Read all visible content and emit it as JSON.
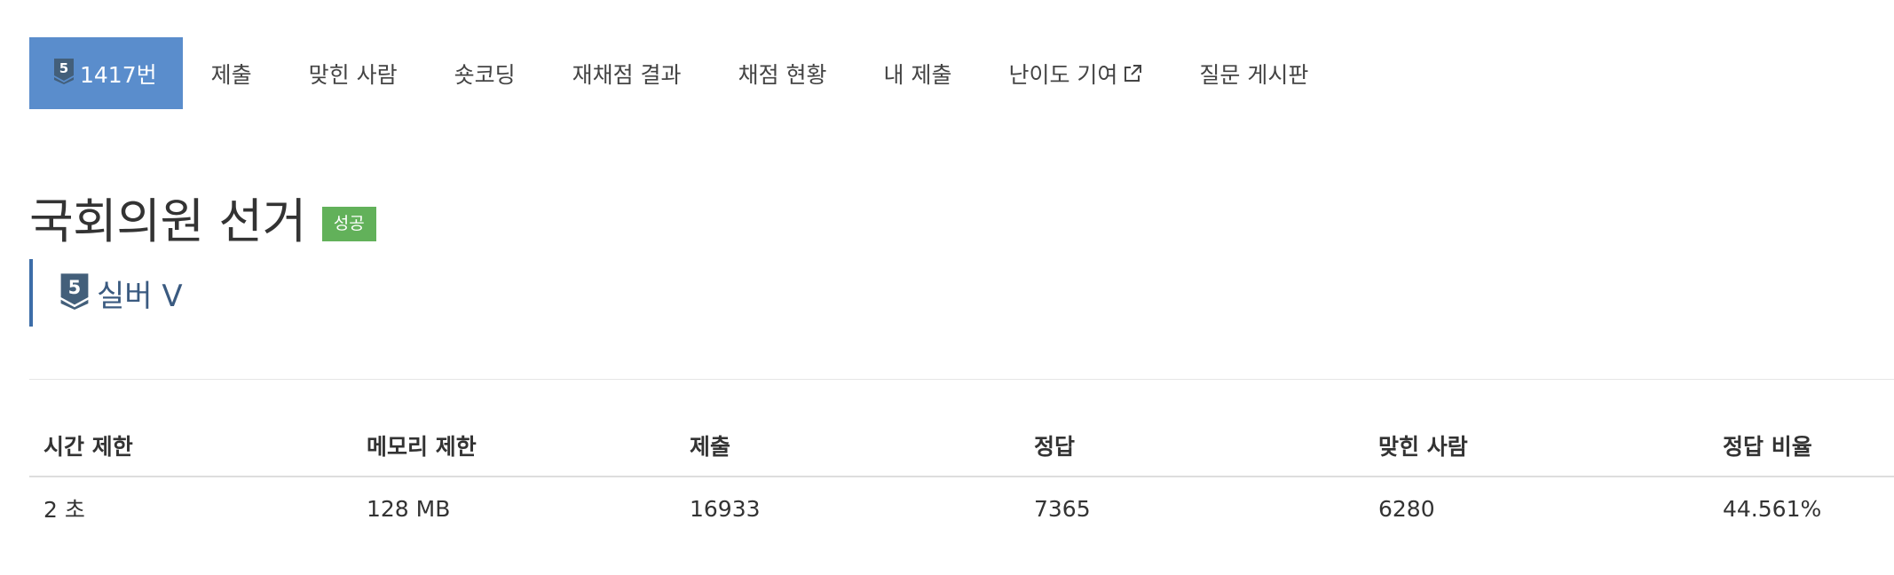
{
  "tabs": [
    {
      "label": "1417번",
      "active": true,
      "tier_icon": "tier-silver-5",
      "tier_digit": "5"
    },
    {
      "label": "제출"
    },
    {
      "label": "맞힌 사람"
    },
    {
      "label": "숏코딩"
    },
    {
      "label": "재채점 결과"
    },
    {
      "label": "채점 현황"
    },
    {
      "label": "내 제출"
    },
    {
      "label": "난이도 기여",
      "icon": "external-link-icon"
    },
    {
      "label": "질문 게시판"
    }
  ],
  "problem": {
    "title": "국회의원 선거",
    "status_badge": "성공",
    "tier_digit": "5",
    "tier_label": "실버 V"
  },
  "stats": {
    "headers": [
      "시간 제한",
      "메모리 제한",
      "제출",
      "정답",
      "맞힌 사람",
      "정답 비율"
    ],
    "values": [
      "2 초",
      "128 MB",
      "16933",
      "7365",
      "6280",
      "44.561%"
    ]
  },
  "colors": {
    "active_tab": "#5a8dcc",
    "badge_success": "#62b15a",
    "tier_silver": "#435f7a",
    "tier_border": "#3d6da8"
  }
}
